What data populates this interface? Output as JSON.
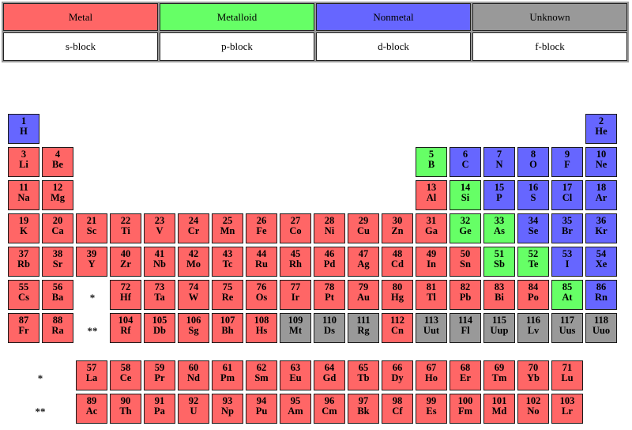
{
  "legend": {
    "categories": [
      {
        "label": "Metal",
        "key": "metal",
        "color": "#ff6666"
      },
      {
        "label": "Metalloid",
        "key": "metalloid",
        "color": "#66ff66"
      },
      {
        "label": "Nonmetal",
        "key": "nonmetal",
        "color": "#6666ff"
      },
      {
        "label": "Unknown",
        "key": "unknown",
        "color": "#999999"
      }
    ],
    "blocks": [
      {
        "label": "s-block"
      },
      {
        "label": "p-block"
      },
      {
        "label": "d-block"
      },
      {
        "label": "f-block"
      }
    ]
  },
  "markers": {
    "lanthanide_marker": "*",
    "actinide_marker": "**"
  },
  "main_rows": [
    [
      {
        "group": 1,
        "number": "1",
        "symbol": "H",
        "category": "nonmetal"
      },
      {
        "group": 18,
        "number": "2",
        "symbol": "He",
        "category": "nonmetal"
      }
    ],
    [
      {
        "group": 1,
        "number": "3",
        "symbol": "Li",
        "category": "metal"
      },
      {
        "group": 2,
        "number": "4",
        "symbol": "Be",
        "category": "metal"
      },
      {
        "group": 13,
        "number": "5",
        "symbol": "B",
        "category": "metalloid"
      },
      {
        "group": 14,
        "number": "6",
        "symbol": "C",
        "category": "nonmetal"
      },
      {
        "group": 15,
        "number": "7",
        "symbol": "N",
        "category": "nonmetal"
      },
      {
        "group": 16,
        "number": "8",
        "symbol": "O",
        "category": "nonmetal"
      },
      {
        "group": 17,
        "number": "9",
        "symbol": "F",
        "category": "nonmetal"
      },
      {
        "group": 18,
        "number": "10",
        "symbol": "Ne",
        "category": "nonmetal"
      }
    ],
    [
      {
        "group": 1,
        "number": "11",
        "symbol": "Na",
        "category": "metal"
      },
      {
        "group": 2,
        "number": "12",
        "symbol": "Mg",
        "category": "metal"
      },
      {
        "group": 13,
        "number": "13",
        "symbol": "Al",
        "category": "metal"
      },
      {
        "group": 14,
        "number": "14",
        "symbol": "Si",
        "category": "metalloid"
      },
      {
        "group": 15,
        "number": "15",
        "symbol": "P",
        "category": "nonmetal"
      },
      {
        "group": 16,
        "number": "16",
        "symbol": "S",
        "category": "nonmetal"
      },
      {
        "group": 17,
        "number": "17",
        "symbol": "Cl",
        "category": "nonmetal"
      },
      {
        "group": 18,
        "number": "18",
        "symbol": "Ar",
        "category": "nonmetal"
      }
    ],
    [
      {
        "group": 1,
        "number": "19",
        "symbol": "K",
        "category": "metal"
      },
      {
        "group": 2,
        "number": "20",
        "symbol": "Ca",
        "category": "metal"
      },
      {
        "group": 3,
        "number": "21",
        "symbol": "Sc",
        "category": "metal"
      },
      {
        "group": 4,
        "number": "22",
        "symbol": "Ti",
        "category": "metal"
      },
      {
        "group": 5,
        "number": "23",
        "symbol": "V",
        "category": "metal"
      },
      {
        "group": 6,
        "number": "24",
        "symbol": "Cr",
        "category": "metal"
      },
      {
        "group": 7,
        "number": "25",
        "symbol": "Mn",
        "category": "metal"
      },
      {
        "group": 8,
        "number": "26",
        "symbol": "Fe",
        "category": "metal"
      },
      {
        "group": 9,
        "number": "27",
        "symbol": "Co",
        "category": "metal"
      },
      {
        "group": 10,
        "number": "28",
        "symbol": "Ni",
        "category": "metal"
      },
      {
        "group": 11,
        "number": "29",
        "symbol": "Cu",
        "category": "metal"
      },
      {
        "group": 12,
        "number": "30",
        "symbol": "Zn",
        "category": "metal"
      },
      {
        "group": 13,
        "number": "31",
        "symbol": "Ga",
        "category": "metal"
      },
      {
        "group": 14,
        "number": "32",
        "symbol": "Ge",
        "category": "metalloid"
      },
      {
        "group": 15,
        "number": "33",
        "symbol": "As",
        "category": "metalloid"
      },
      {
        "group": 16,
        "number": "34",
        "symbol": "Se",
        "category": "nonmetal"
      },
      {
        "group": 17,
        "number": "35",
        "symbol": "Br",
        "category": "nonmetal"
      },
      {
        "group": 18,
        "number": "36",
        "symbol": "Kr",
        "category": "nonmetal"
      }
    ],
    [
      {
        "group": 1,
        "number": "37",
        "symbol": "Rb",
        "category": "metal"
      },
      {
        "group": 2,
        "number": "38",
        "symbol": "Sr",
        "category": "metal"
      },
      {
        "group": 3,
        "number": "39",
        "symbol": "Y",
        "category": "metal"
      },
      {
        "group": 4,
        "number": "40",
        "symbol": "Zr",
        "category": "metal"
      },
      {
        "group": 5,
        "number": "41",
        "symbol": "Nb",
        "category": "metal"
      },
      {
        "group": 6,
        "number": "42",
        "symbol": "Mo",
        "category": "metal"
      },
      {
        "group": 7,
        "number": "43",
        "symbol": "Tc",
        "category": "metal"
      },
      {
        "group": 8,
        "number": "44",
        "symbol": "Ru",
        "category": "metal"
      },
      {
        "group": 9,
        "number": "45",
        "symbol": "Rh",
        "category": "metal"
      },
      {
        "group": 10,
        "number": "46",
        "symbol": "Pd",
        "category": "metal"
      },
      {
        "group": 11,
        "number": "47",
        "symbol": "Ag",
        "category": "metal"
      },
      {
        "group": 12,
        "number": "48",
        "symbol": "Cd",
        "category": "metal"
      },
      {
        "group": 13,
        "number": "49",
        "symbol": "In",
        "category": "metal"
      },
      {
        "group": 14,
        "number": "50",
        "symbol": "Sn",
        "category": "metal"
      },
      {
        "group": 15,
        "number": "51",
        "symbol": "Sb",
        "category": "metalloid"
      },
      {
        "group": 16,
        "number": "52",
        "symbol": "Te",
        "category": "metalloid"
      },
      {
        "group": 17,
        "number": "53",
        "symbol": "I",
        "category": "nonmetal"
      },
      {
        "group": 18,
        "number": "54",
        "symbol": "Xe",
        "category": "nonmetal"
      }
    ],
    [
      {
        "group": 1,
        "number": "55",
        "symbol": "Cs",
        "category": "metal"
      },
      {
        "group": 2,
        "number": "56",
        "symbol": "Ba",
        "category": "metal"
      },
      {
        "group": 3,
        "marker": "*"
      },
      {
        "group": 4,
        "number": "72",
        "symbol": "Hf",
        "category": "metal"
      },
      {
        "group": 5,
        "number": "73",
        "symbol": "Ta",
        "category": "metal"
      },
      {
        "group": 6,
        "number": "74",
        "symbol": "W",
        "category": "metal"
      },
      {
        "group": 7,
        "number": "75",
        "symbol": "Re",
        "category": "metal"
      },
      {
        "group": 8,
        "number": "76",
        "symbol": "Os",
        "category": "metal"
      },
      {
        "group": 9,
        "number": "77",
        "symbol": "Ir",
        "category": "metal"
      },
      {
        "group": 10,
        "number": "78",
        "symbol": "Pt",
        "category": "metal"
      },
      {
        "group": 11,
        "number": "79",
        "symbol": "Au",
        "category": "metal"
      },
      {
        "group": 12,
        "number": "80",
        "symbol": "Hg",
        "category": "metal"
      },
      {
        "group": 13,
        "number": "81",
        "symbol": "Tl",
        "category": "metal"
      },
      {
        "group": 14,
        "number": "82",
        "symbol": "Pb",
        "category": "metal"
      },
      {
        "group": 15,
        "number": "83",
        "symbol": "Bi",
        "category": "metal"
      },
      {
        "group": 16,
        "number": "84",
        "symbol": "Po",
        "category": "metal"
      },
      {
        "group": 17,
        "number": "85",
        "symbol": "At",
        "category": "metalloid"
      },
      {
        "group": 18,
        "number": "86",
        "symbol": "Rn",
        "category": "nonmetal"
      }
    ],
    [
      {
        "group": 1,
        "number": "87",
        "symbol": "Fr",
        "category": "metal"
      },
      {
        "group": 2,
        "number": "88",
        "symbol": "Ra",
        "category": "metal"
      },
      {
        "group": 3,
        "marker": "**"
      },
      {
        "group": 4,
        "number": "104",
        "symbol": "Rf",
        "category": "metal"
      },
      {
        "group": 5,
        "number": "105",
        "symbol": "Db",
        "category": "metal"
      },
      {
        "group": 6,
        "number": "106",
        "symbol": "Sg",
        "category": "metal"
      },
      {
        "group": 7,
        "number": "107",
        "symbol": "Bh",
        "category": "metal"
      },
      {
        "group": 8,
        "number": "108",
        "symbol": "Hs",
        "category": "metal"
      },
      {
        "group": 9,
        "number": "109",
        "symbol": "Mt",
        "category": "unknown"
      },
      {
        "group": 10,
        "number": "110",
        "symbol": "Ds",
        "category": "unknown"
      },
      {
        "group": 11,
        "number": "111",
        "symbol": "Rg",
        "category": "unknown"
      },
      {
        "group": 12,
        "number": "112",
        "symbol": "Cn",
        "category": "metal"
      },
      {
        "group": 13,
        "number": "113",
        "symbol": "Uut",
        "category": "unknown"
      },
      {
        "group": 14,
        "number": "114",
        "symbol": "Fl",
        "category": "unknown"
      },
      {
        "group": 15,
        "number": "115",
        "symbol": "Uup",
        "category": "unknown"
      },
      {
        "group": 16,
        "number": "116",
        "symbol": "Lv",
        "category": "unknown"
      },
      {
        "group": 17,
        "number": "117",
        "symbol": "Uus",
        "category": "unknown"
      },
      {
        "group": 18,
        "number": "118",
        "symbol": "Uuo",
        "category": "unknown"
      }
    ]
  ],
  "fblock_rows": [
    {
      "marker": "*",
      "cells": [
        {
          "number": "57",
          "symbol": "La",
          "category": "metal"
        },
        {
          "number": "58",
          "symbol": "Ce",
          "category": "metal"
        },
        {
          "number": "59",
          "symbol": "Pr",
          "category": "metal"
        },
        {
          "number": "60",
          "symbol": "Nd",
          "category": "metal"
        },
        {
          "number": "61",
          "symbol": "Pm",
          "category": "metal"
        },
        {
          "number": "62",
          "symbol": "Sm",
          "category": "metal"
        },
        {
          "number": "63",
          "symbol": "Eu",
          "category": "metal"
        },
        {
          "number": "64",
          "symbol": "Gd",
          "category": "metal"
        },
        {
          "number": "65",
          "symbol": "Tb",
          "category": "metal"
        },
        {
          "number": "66",
          "symbol": "Dy",
          "category": "metal"
        },
        {
          "number": "67",
          "symbol": "Ho",
          "category": "metal"
        },
        {
          "number": "68",
          "symbol": "Er",
          "category": "metal"
        },
        {
          "number": "69",
          "symbol": "Tm",
          "category": "metal"
        },
        {
          "number": "70",
          "symbol": "Yb",
          "category": "metal"
        },
        {
          "number": "71",
          "symbol": "Lu",
          "category": "metal"
        }
      ]
    },
    {
      "marker": "**",
      "cells": [
        {
          "number": "89",
          "symbol": "Ac",
          "category": "metal"
        },
        {
          "number": "90",
          "symbol": "Th",
          "category": "metal"
        },
        {
          "number": "91",
          "symbol": "Pa",
          "category": "metal"
        },
        {
          "number": "92",
          "symbol": "U",
          "category": "metal"
        },
        {
          "number": "93",
          "symbol": "Np",
          "category": "metal"
        },
        {
          "number": "94",
          "symbol": "Pu",
          "category": "metal"
        },
        {
          "number": "95",
          "symbol": "Am",
          "category": "metal"
        },
        {
          "number": "96",
          "symbol": "Cm",
          "category": "metal"
        },
        {
          "number": "97",
          "symbol": "Bk",
          "category": "metal"
        },
        {
          "number": "98",
          "symbol": "Cf",
          "category": "metal"
        },
        {
          "number": "99",
          "symbol": "Es",
          "category": "metal"
        },
        {
          "number": "100",
          "symbol": "Fm",
          "category": "metal"
        },
        {
          "number": "101",
          "symbol": "Md",
          "category": "metal"
        },
        {
          "number": "102",
          "symbol": "No",
          "category": "metal"
        },
        {
          "number": "103",
          "symbol": "Lr",
          "category": "metal"
        }
      ]
    }
  ]
}
